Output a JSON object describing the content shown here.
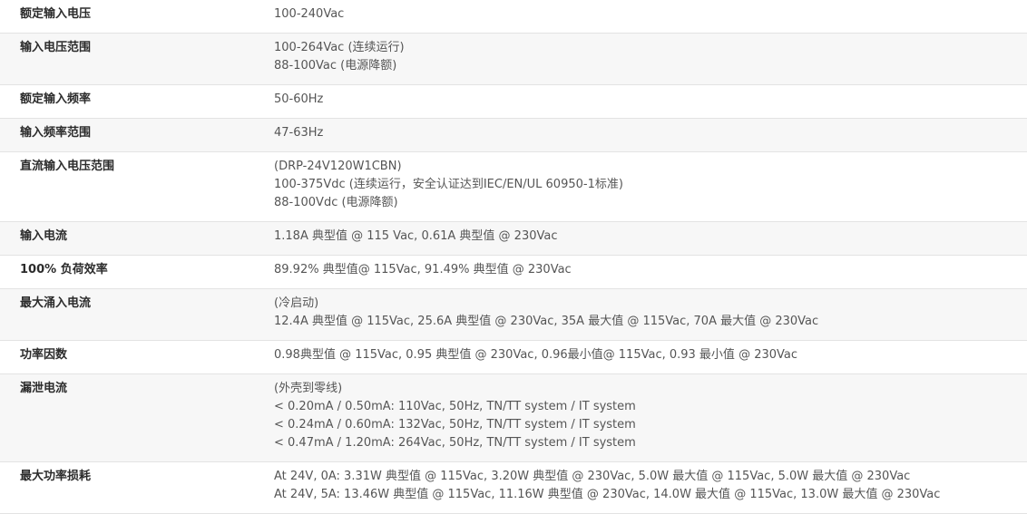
{
  "rows": [
    {
      "label": "额定输入电压",
      "lines": [
        "100-240Vac"
      ]
    },
    {
      "label": "输入电压范围",
      "lines": [
        "100-264Vac (连续运行)",
        "88-100Vac (电源降额)"
      ]
    },
    {
      "label": "额定输入频率",
      "lines": [
        "50-60Hz"
      ]
    },
    {
      "label": "输入频率范围",
      "lines": [
        "47-63Hz"
      ]
    },
    {
      "label": "直流输入电压范围",
      "lines": [
        "(DRP-24V120W1CBN)",
        "100-375Vdc (连续运行，安全认证达到IEC/EN/UL 60950-1标准)",
        "88-100Vdc (电源降额)"
      ]
    },
    {
      "label": "输入电流",
      "lines": [
        "1.18A 典型值 @ 115 Vac, 0.61A 典型值 @ 230Vac"
      ]
    },
    {
      "label": "100% 负荷效率",
      "lines": [
        "89.92% 典型值@ 115Vac, 91.49% 典型值 @ 230Vac"
      ]
    },
    {
      "label": "最大涌入电流",
      "lines": [
        "(冷启动)",
        "12.4A 典型值 @ 115Vac, 25.6A 典型值 @ 230Vac, 35A 最大值 @ 115Vac, 70A 最大值 @ 230Vac"
      ]
    },
    {
      "label": "功率因数",
      "lines": [
        "0.98典型值 @ 115Vac, 0.95 典型值 @ 230Vac, 0.96最小值@ 115Vac, 0.93 最小值 @ 230Vac"
      ]
    },
    {
      "label": "漏泄电流",
      "lines": [
        "(外壳到零线)",
        "< 0.20mA / 0.50mA: 110Vac, 50Hz, TN/TT system / IT system",
        "< 0.24mA / 0.60mA: 132Vac, 50Hz, TN/TT system / IT system",
        "< 0.47mA / 1.20mA: 264Vac, 50Hz, TN/TT system / IT system"
      ]
    },
    {
      "label": "最大功率损耗",
      "lines": [
        "At 24V, 0A: 3.31W 典型值 @ 115Vac, 3.20W 典型值 @ 230Vac, 5.0W 最大值 @ 115Vac, 5.0W 最大值 @ 230Vac",
        "At 24V, 5A: 13.46W 典型值 @ 115Vac, 11.16W 典型值 @ 230Vac, 14.0W 最大值 @ 115Vac, 13.0W 最大值 @ 230Vac"
      ]
    }
  ]
}
